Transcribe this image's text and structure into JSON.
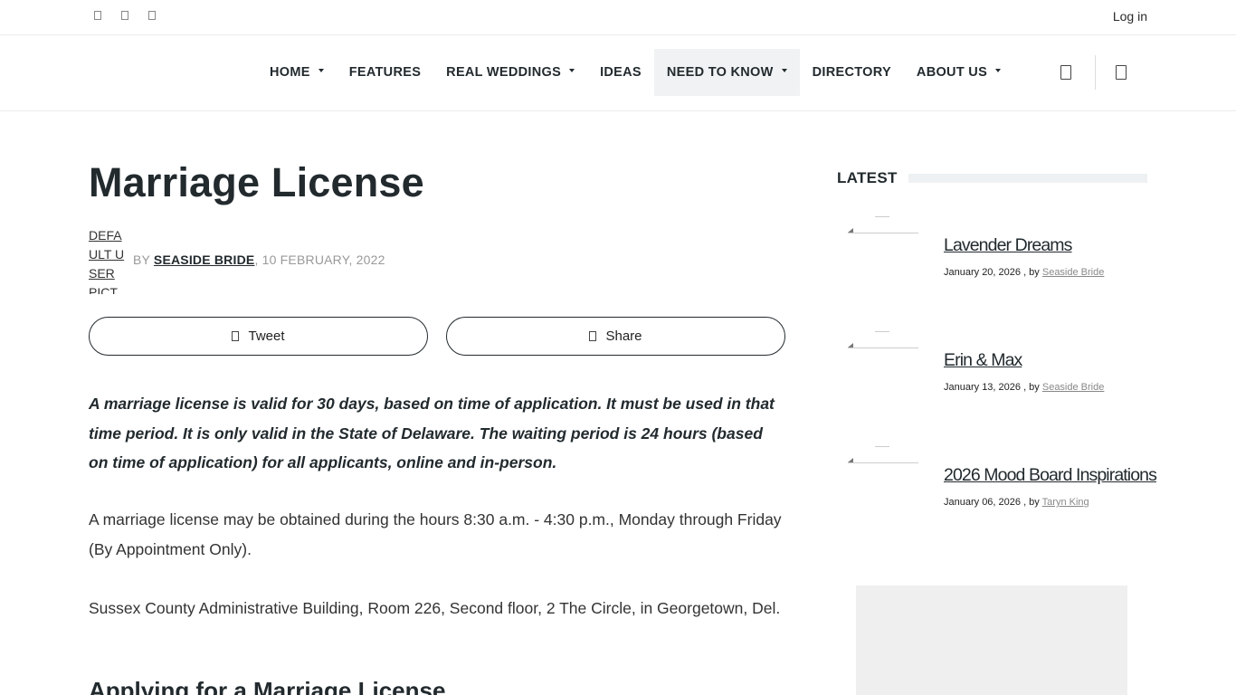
{
  "topbar": {
    "social_icons": [
      "facebook-icon",
      "instagram-icon",
      "pinterest-icon"
    ],
    "login_label": "Log in"
  },
  "nav": {
    "items": [
      {
        "label": "HOME",
        "has_dropdown": true
      },
      {
        "label": "FEATURES",
        "has_dropdown": false
      },
      {
        "label": "REAL WEDDINGS",
        "has_dropdown": true
      },
      {
        "label": "IDEAS",
        "has_dropdown": false
      },
      {
        "label": "NEED TO KNOW",
        "has_dropdown": true,
        "active": true
      },
      {
        "label": "DIRECTORY",
        "has_dropdown": false
      },
      {
        "label": "ABOUT US",
        "has_dropdown": true
      }
    ],
    "icons": [
      "search-icon",
      "bag-icon"
    ]
  },
  "article": {
    "title": "Marriage License",
    "avatar_alt": "DEFAULT USER PICTURE",
    "by_prefix": "BY",
    "author": "SEASIDE BRIDE",
    "date": ", 10 FEBRUARY, 2022",
    "share_buttons": [
      {
        "label": "Tweet",
        "icon": "twitter-icon"
      },
      {
        "label": "Share",
        "icon": "facebook-icon"
      }
    ],
    "lead": "A marriage license is valid for 30 days, based on time of application. It must be used in that time period. It is only valid in the State of Delaware. The waiting period is 24 hours (based on time of application) for all applicants, online and in-person.",
    "para1": "A marriage license may be obtained during the hours 8:30 a.m. - 4:30 p.m., Monday through Friday (By Appointment Only).",
    "para2": "Sussex County Administrative Building, Room 226, Second floor, 2 The Circle,  in Georgetown, Del.",
    "heading2": "Applying for a Marriage License"
  },
  "sidebar": {
    "heading": "LATEST",
    "posts": [
      {
        "title": "Lavender Dreams",
        "date": "January 20, 2026",
        "by": " , by ",
        "author": "Seaside Bride"
      },
      {
        "title": "Erin & Max",
        "date": "January 13, 2026",
        "by": " , by ",
        "author": "Seaside Bride"
      },
      {
        "title": "2026 Mood Board Inspirations",
        "date": "January 06, 2026",
        "by": " , by ",
        "author": "Taryn King"
      }
    ]
  },
  "colors": {
    "text": "#222a2e",
    "nav_active_bg": "#f1f2f3",
    "muted": "#999999",
    "ad_bg": "#efefef"
  }
}
